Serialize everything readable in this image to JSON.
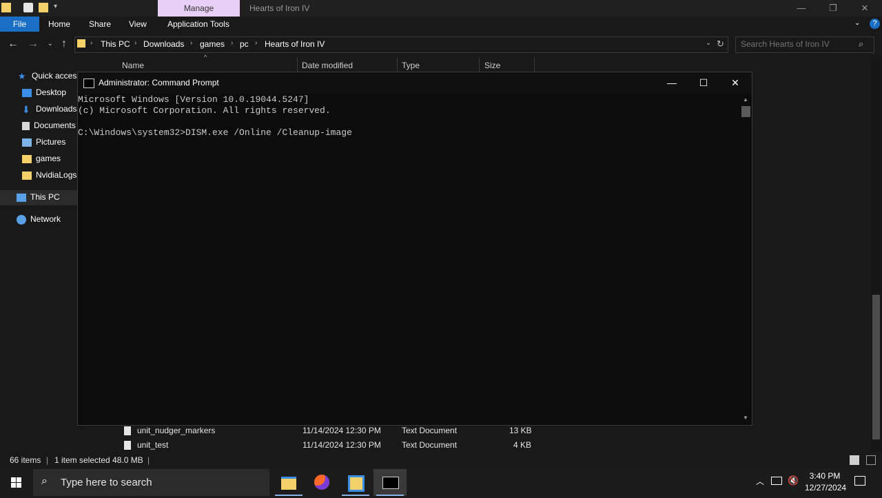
{
  "explorer": {
    "manage_tab": "Manage",
    "window_title": "Hearts of Iron IV",
    "ribbon": {
      "file": "File",
      "home": "Home",
      "share": "Share",
      "view": "View",
      "app_tools": "Application Tools"
    },
    "breadcrumbs": [
      "This PC",
      "Downloads",
      "games",
      "pc",
      "Hearts of Iron IV"
    ],
    "search_placeholder": "Search Hearts of Iron IV",
    "nav": {
      "quick_access": "Quick access",
      "desktop": "Desktop",
      "downloads": "Downloads",
      "documents": "Documents",
      "pictures": "Pictures",
      "games": "games",
      "nvidialogs": "NvidiaLogs",
      "this_pc": "This PC",
      "network": "Network"
    },
    "columns": {
      "name": "Name",
      "date": "Date modified",
      "type": "Type",
      "size": "Size"
    },
    "files": [
      {
        "name": "unit_nudger_markers",
        "date": "11/14/2024 12:30 PM",
        "type": "Text Document",
        "size": "13 KB"
      },
      {
        "name": "unit_test",
        "date": "11/14/2024 12:30 PM",
        "type": "Text Document",
        "size": "4 KB"
      }
    ],
    "status": {
      "items": "66 items",
      "selected": "1 item selected  48.0 MB"
    }
  },
  "cmd": {
    "title": "Administrator: Command Prompt",
    "lines": [
      "Microsoft Windows [Version 10.0.19044.5247]",
      "(c) Microsoft Corporation. All rights reserved.",
      "",
      "C:\\Windows\\system32>DISM.exe /Online /Cleanup-image"
    ]
  },
  "taskbar": {
    "search_placeholder": "Type here to search",
    "time": "3:40 PM",
    "date": "12/27/2024"
  },
  "colors": {
    "accent": "#1a6fc4",
    "manage": "#e8cff5",
    "folder": "#f4d16a"
  }
}
